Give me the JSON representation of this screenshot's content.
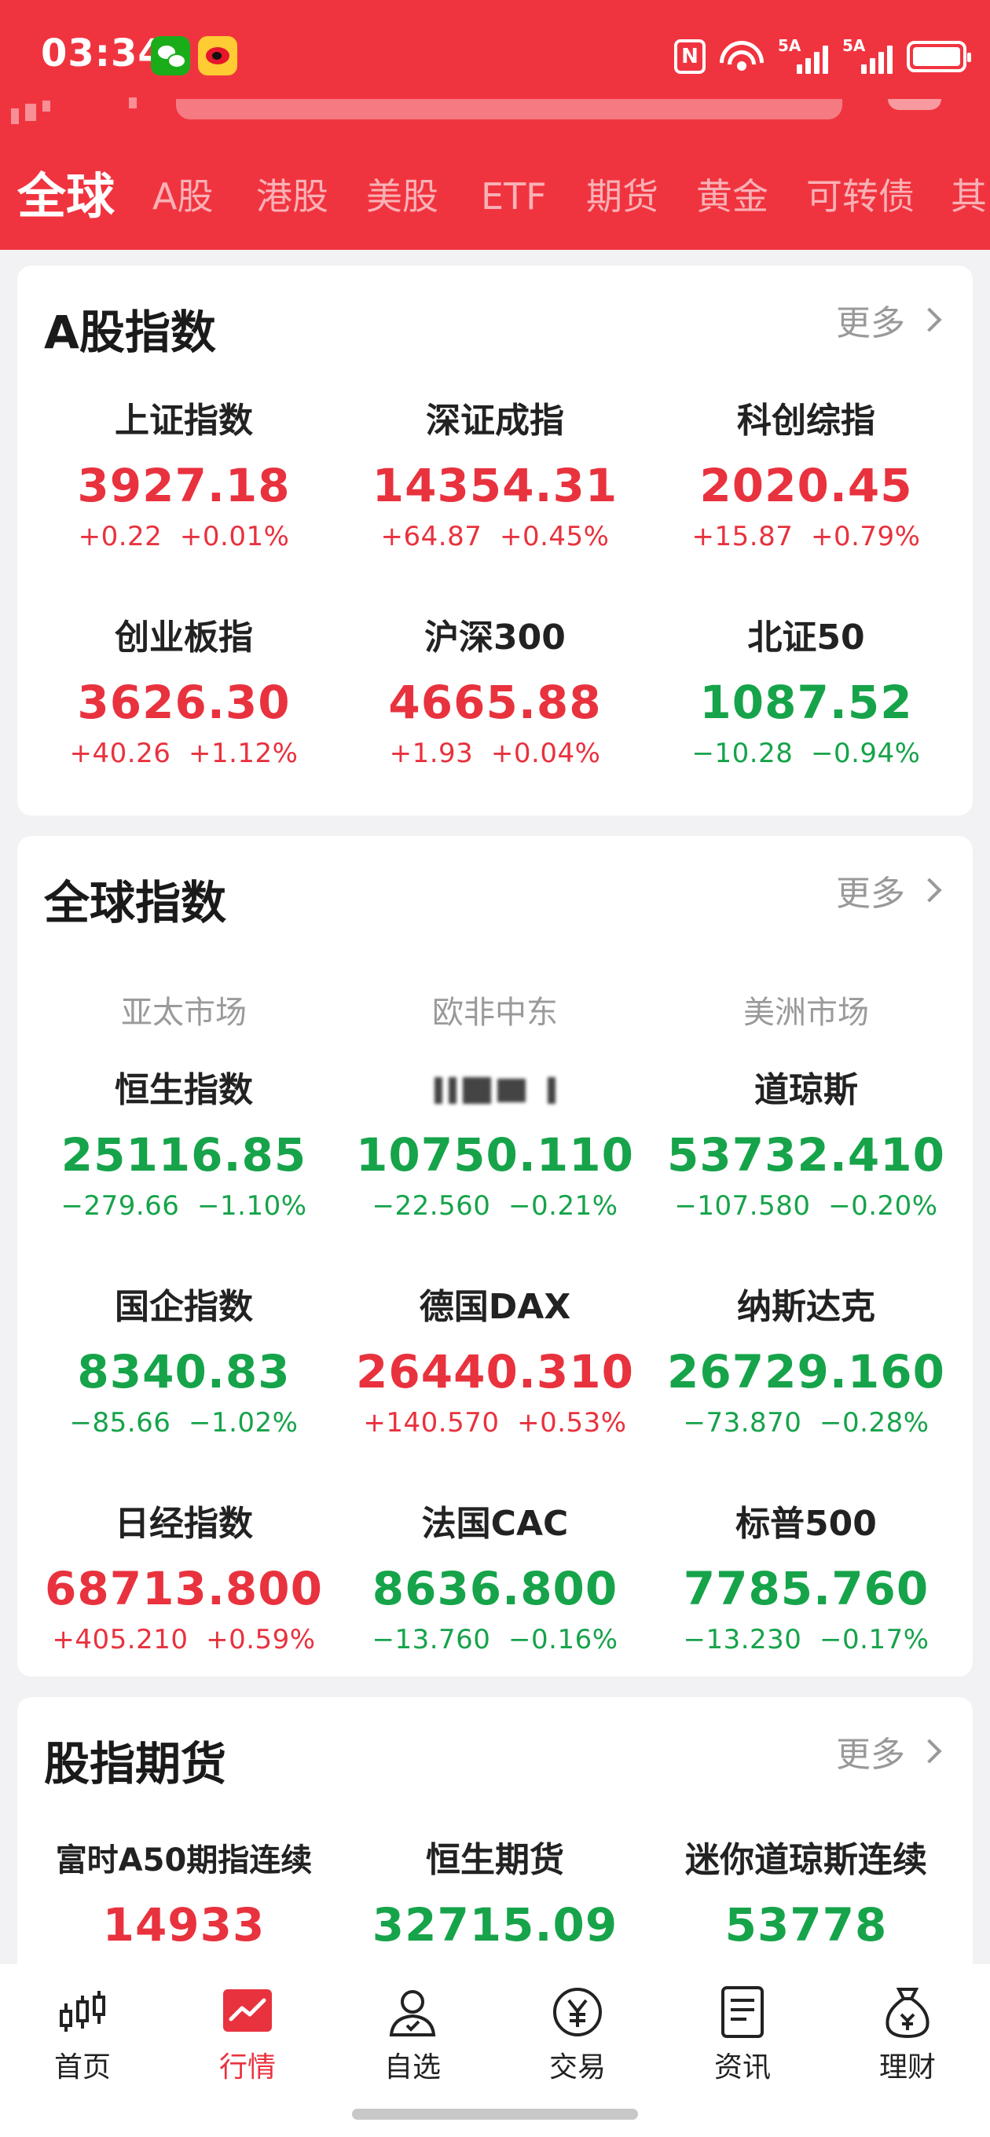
{
  "status_bar": {
    "time": "03:34",
    "nfc_label": "N",
    "sim1_label": "5A",
    "sim2_label": "5A",
    "icons": [
      "wechat-icon",
      "weibo-icon",
      "nfc-icon",
      "wifi-icon",
      "signal-icon",
      "signal-icon",
      "battery-icon"
    ]
  },
  "tabs": [
    "全球",
    "A股",
    "港股",
    "美股",
    "ETF",
    "期货",
    "黄金",
    "可转债",
    "其"
  ],
  "active_tab": "全球",
  "colors": {
    "header": "#f0343f",
    "up": "#e8323e",
    "down": "#16a34a",
    "muted": "#999999"
  },
  "a_share": {
    "title": "A股指数",
    "more": "更多",
    "items": [
      {
        "name": "上证指数",
        "price": "3927.18",
        "change": "+0.22",
        "pct": "+0.01%",
        "dir": "up"
      },
      {
        "name": "深证成指",
        "price": "14354.31",
        "change": "+64.87",
        "pct": "+0.45%",
        "dir": "up"
      },
      {
        "name": "科创综指",
        "price": "2020.45",
        "change": "+15.87",
        "pct": "+0.79%",
        "dir": "up"
      },
      {
        "name": "创业板指",
        "price": "3626.30",
        "change": "+40.26",
        "pct": "+1.12%",
        "dir": "up"
      },
      {
        "name": "沪深300",
        "price": "4665.88",
        "change": "+1.93",
        "pct": "+0.04%",
        "dir": "up"
      },
      {
        "name": "北证50",
        "price": "1087.52",
        "change": "−10.28",
        "pct": "−0.94%",
        "dir": "down"
      }
    ]
  },
  "global": {
    "title": "全球指数",
    "more": "更多",
    "regions": [
      "亚太市场",
      "欧非中东",
      "美洲市场"
    ],
    "items": [
      {
        "name": "恒生指数",
        "price": "25116.85",
        "change": "−279.66",
        "pct": "−1.10%",
        "dir": "down"
      },
      {
        "name": "",
        "price": "10750.110",
        "change": "−22.560",
        "pct": "−0.21%",
        "dir": "down"
      },
      {
        "name": "道琼斯",
        "price": "53732.410",
        "change": "−107.580",
        "pct": "−0.20%",
        "dir": "down"
      },
      {
        "name": "国企指数",
        "price": "8340.83",
        "change": "−85.66",
        "pct": "−1.02%",
        "dir": "down"
      },
      {
        "name": "德国DAX",
        "price": "26440.310",
        "change": "+140.570",
        "pct": "+0.53%",
        "dir": "up"
      },
      {
        "name": "纳斯达克",
        "price": "26729.160",
        "change": "−73.870",
        "pct": "−0.28%",
        "dir": "down"
      },
      {
        "name": "日经指数",
        "price": "68713.800",
        "change": "+405.210",
        "pct": "+0.59%",
        "dir": "up"
      },
      {
        "name": "法国CAC",
        "price": "8636.800",
        "change": "−13.760",
        "pct": "−0.16%",
        "dir": "down"
      },
      {
        "name": "标普500",
        "price": "7785.760",
        "change": "−13.230",
        "pct": "−0.17%",
        "dir": "down"
      }
    ]
  },
  "futures": {
    "title": "股指期货",
    "more": "更多",
    "items": [
      {
        "name": "富时A50期指连续",
        "price": "14933",
        "dir": "up"
      },
      {
        "name": "恒生期货",
        "price": "32715.09",
        "dir": "down"
      },
      {
        "name": "迷你道琼斯连续",
        "price": "53778",
        "dir": "down"
      }
    ]
  },
  "bottom_nav": [
    {
      "label": "首页",
      "icon": "candlestick-icon"
    },
    {
      "label": "行情",
      "icon": "market-chart-icon"
    },
    {
      "label": "自选",
      "icon": "user-star-icon"
    },
    {
      "label": "交易",
      "icon": "yen-circle-icon"
    },
    {
      "label": "资讯",
      "icon": "document-icon"
    },
    {
      "label": "理财",
      "icon": "money-bag-icon"
    }
  ],
  "active_nav": "行情"
}
